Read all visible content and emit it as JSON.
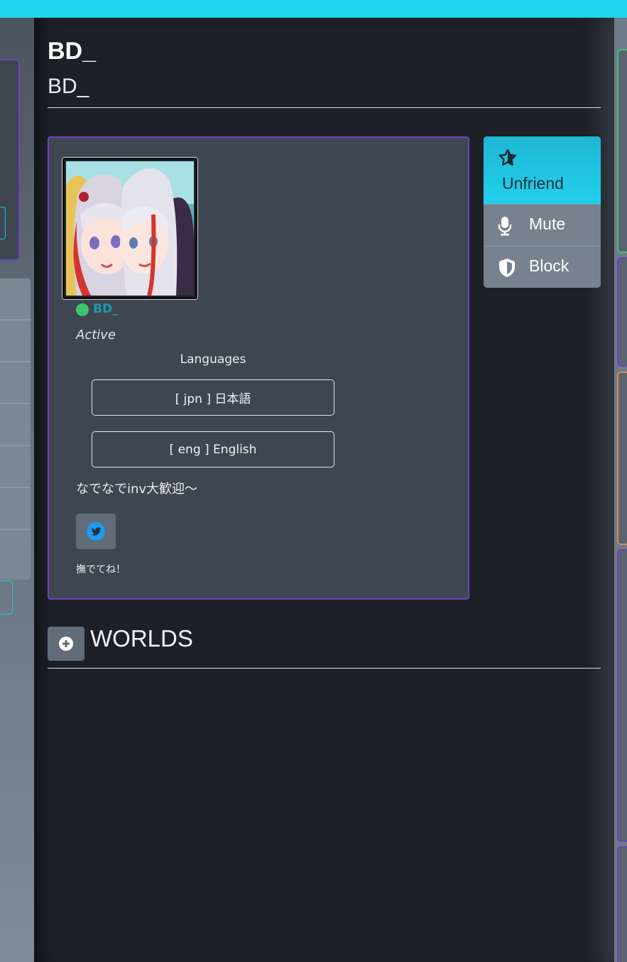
{
  "profile": {
    "display_name": "BD_",
    "username_sub": "BD_",
    "status_color": "#3ec46d",
    "card_username": "BD_",
    "status_text": "Active",
    "languages_heading": "Languages",
    "languages": [
      {
        "label": "[ jpn ] 日本語"
      },
      {
        "label": "[ eng ] English"
      }
    ],
    "bio": "なでなでinv大歓迎～",
    "social": {
      "icon": "twitter-icon",
      "label": "撫でてね！"
    }
  },
  "actions": {
    "unfriend": {
      "label": "Unfriend",
      "icon": "star-icon"
    },
    "mute": {
      "label": "Mute",
      "icon": "microphone-icon"
    },
    "block": {
      "label": "Block",
      "icon": "shield-icon"
    }
  },
  "worlds": {
    "title": "WORLDS",
    "add_icon": "plus-circle-icon"
  },
  "colors": {
    "accent_cyan": "#20d3ee",
    "card_border_purple": "#6f42c1",
    "username_teal": "#1a98ad"
  }
}
